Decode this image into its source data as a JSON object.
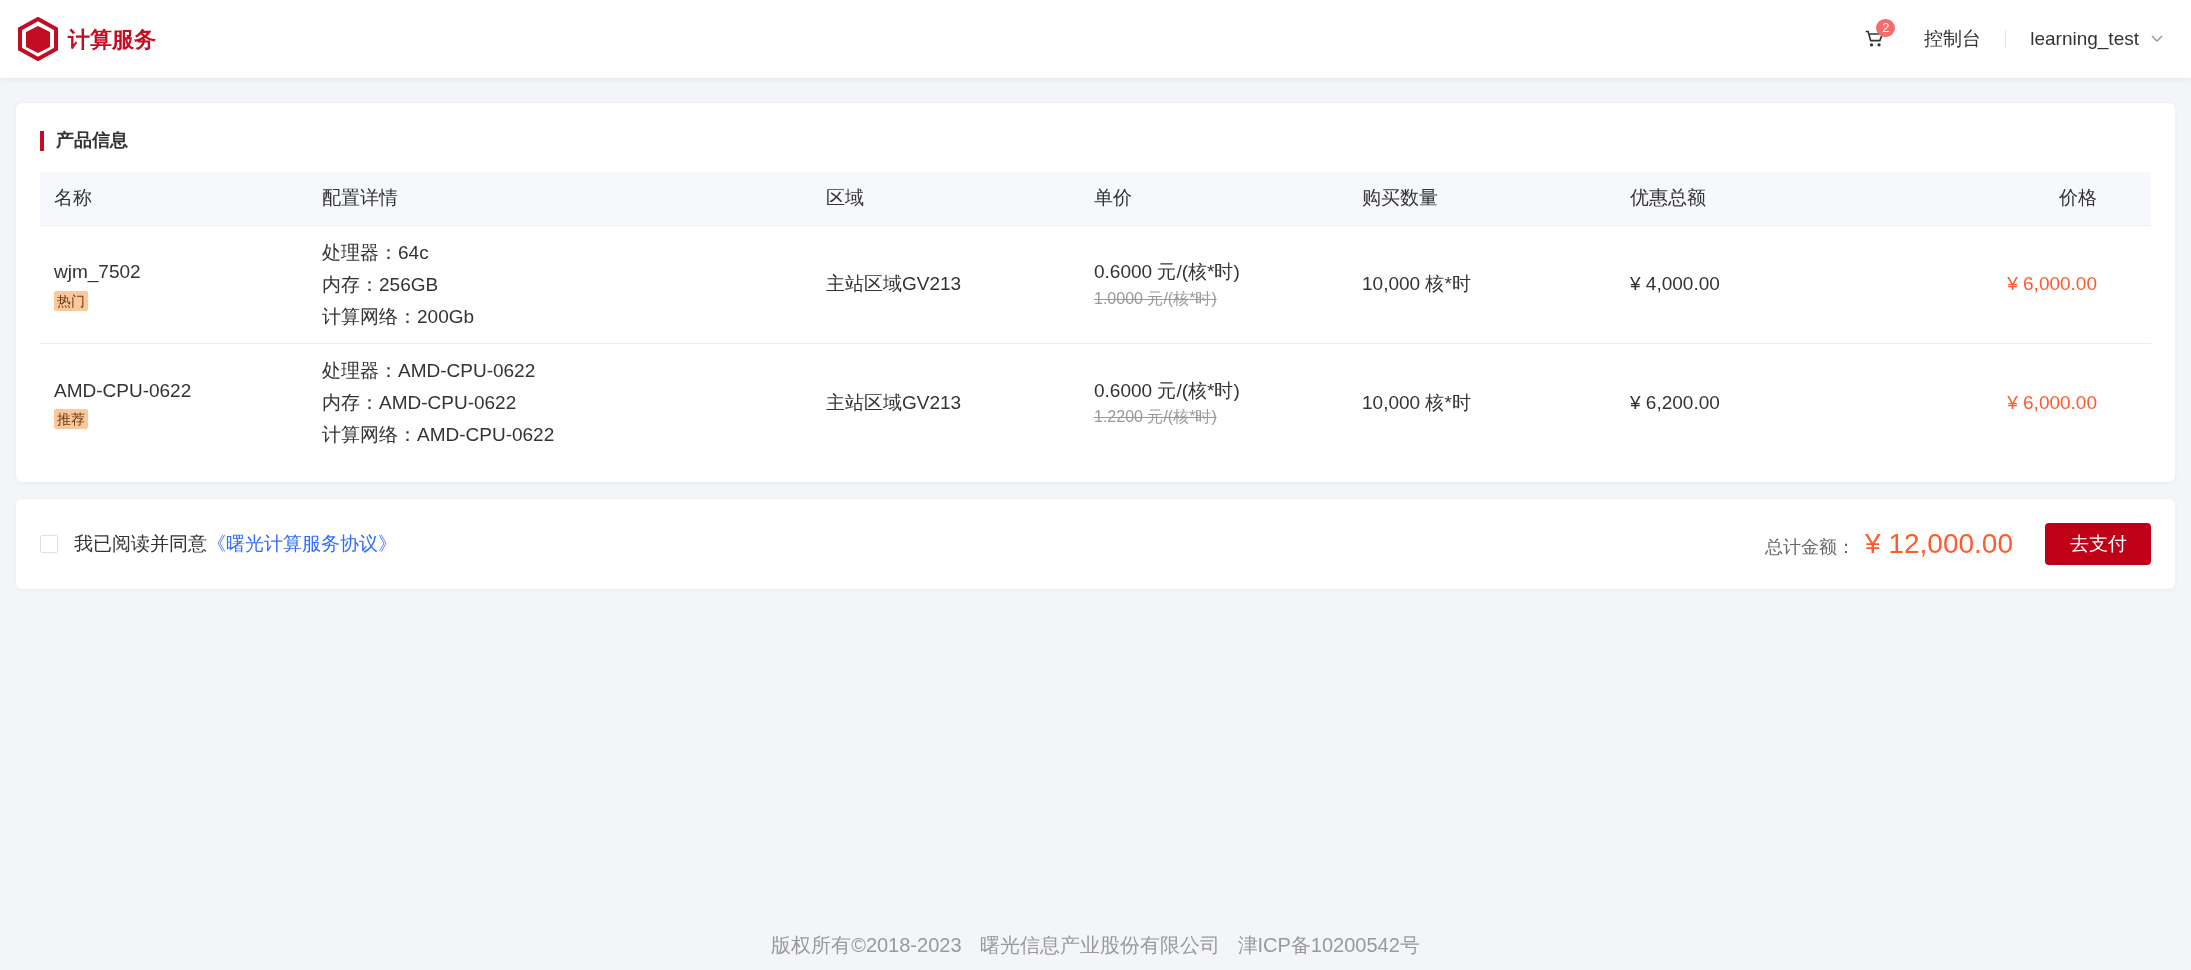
{
  "header": {
    "brand": "计算服务",
    "cart_count": "2",
    "console": "控制台",
    "user": "learning_test"
  },
  "product_card": {
    "title": "产品信息",
    "table": {
      "columns": [
        "名称",
        "配置详情",
        "区域",
        "单价",
        "购买数量",
        "优惠总额",
        "价格"
      ],
      "rows": [
        {
          "name": "wjm_7502",
          "tag": "热门",
          "config": [
            "处理器：64c",
            "内存：256GB",
            "计算网络：200Gb"
          ],
          "region": "主站区域GV213",
          "unit_price": "0.6000 元/(核*时)",
          "original_price": "1.0000 元/(核*时)",
          "quantity": "10,000 核*时",
          "discount": "¥ 4,000.00",
          "price": "¥ 6,000.00"
        },
        {
          "name": "AMD-CPU-0622",
          "tag": "推荐",
          "config": [
            "处理器：AMD-CPU-0622",
            "内存：AMD-CPU-0622",
            "计算网络：AMD-CPU-0622"
          ],
          "region": "主站区域GV213",
          "unit_price": "0.6000 元/(核*时)",
          "original_price": "1.2200 元/(核*时)",
          "quantity": "10,000 核*时",
          "discount": "¥ 6,200.00",
          "price": "¥ 6,000.00"
        }
      ]
    }
  },
  "checkout": {
    "agree_checked": false,
    "agree_text": "我已阅读并同意",
    "agreement_link": "《曙光计算服务协议》",
    "total_label": "总计金额：",
    "total": "¥ 12,000.00",
    "pay_button": "去支付"
  },
  "footer": {
    "copyright": "版权所有©2018-2023",
    "company": "曙光信息产业股份有限公司",
    "icp": "津ICP备10200542号"
  }
}
